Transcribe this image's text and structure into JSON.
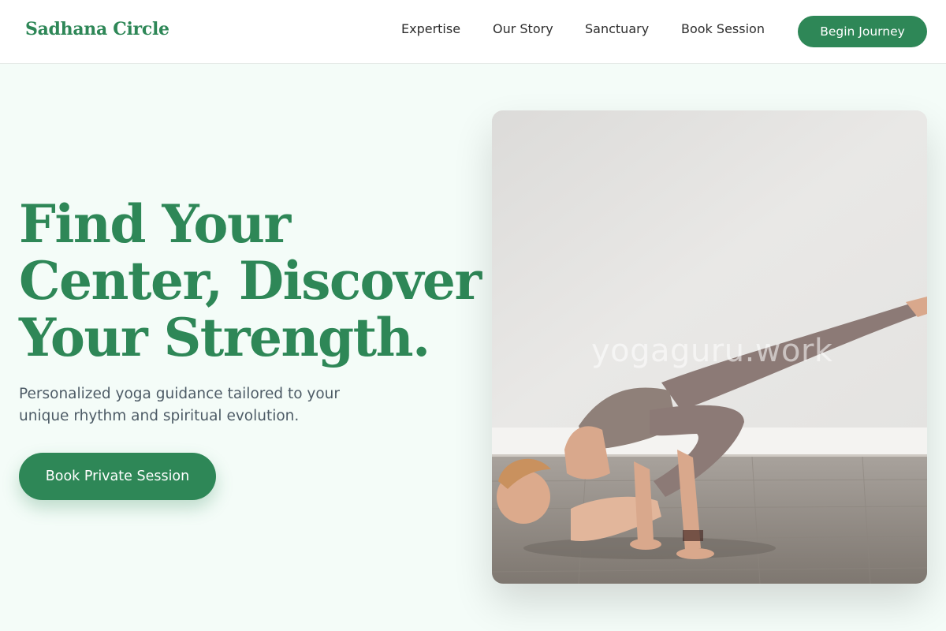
{
  "header": {
    "logo": "Sadhana Circle",
    "nav": [
      {
        "label": "Expertise"
      },
      {
        "label": "Our Story"
      },
      {
        "label": "Sanctuary"
      },
      {
        "label": "Book Session"
      }
    ],
    "cta_label": "Begin Journey"
  },
  "hero": {
    "headline_lines": [
      "Find Your",
      "Center, Discover",
      "Your Strength."
    ],
    "subtext_lines": [
      "Personalized yoga guidance tailored to your",
      "unique rhythm and spiritual evolution."
    ],
    "cta_label": "Book Private Session",
    "image": {
      "icon": "yoga-pose-photo",
      "watermark": "yogaguru.work"
    }
  },
  "colors": {
    "brand_green": "#2e8757",
    "page_background": "#f4fcf8",
    "body_text": "#4d5b66"
  }
}
